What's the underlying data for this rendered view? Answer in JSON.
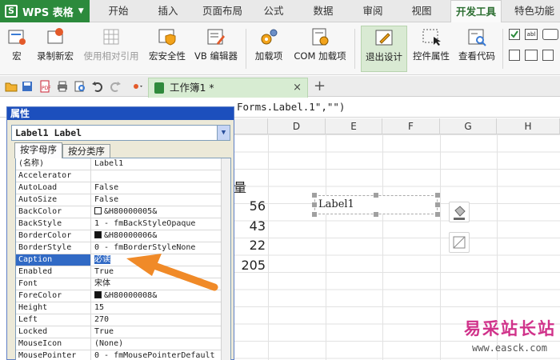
{
  "app": {
    "name": "WPS 表格",
    "logo_letter": "S"
  },
  "tabs": [
    {
      "label": "开始"
    },
    {
      "label": "插入"
    },
    {
      "label": "页面布局"
    },
    {
      "label": "公式"
    },
    {
      "label": "数据"
    },
    {
      "label": "审阅"
    },
    {
      "label": "视图"
    },
    {
      "label": "开发工具"
    },
    {
      "label": "特色功能"
    }
  ],
  "ribbon": {
    "macro": "宏",
    "record_macro": "录制新宏",
    "relative_ref": "使用相对引用",
    "macro_security": "宏安全性",
    "vb_editor": "VB 编辑器",
    "addins": "加载项",
    "com_addins": "COM 加载项",
    "exit_design": "退出设计",
    "control_props": "控件属性",
    "view_code": "查看代码"
  },
  "document": {
    "tab_name": "工作簿1 *",
    "close": "×",
    "new_tab": "+"
  },
  "formula_bar": {
    "content": "Forms.Label.1\",\"\")"
  },
  "sheet": {
    "columns": [
      "D",
      "E",
      "F",
      "G",
      "H"
    ],
    "partial_header": "量",
    "values": [
      "56",
      "43",
      "22",
      "205"
    ],
    "label_control_text": "Label1"
  },
  "properties": {
    "title": "属性",
    "object": "Label1 Label",
    "tab_alpha": "按字母序",
    "tab_category": "按分类序",
    "rows": [
      {
        "name": "(名称)",
        "value": "Label1"
      },
      {
        "name": "Accelerator",
        "value": ""
      },
      {
        "name": "AutoLoad",
        "value": "False"
      },
      {
        "name": "AutoSize",
        "value": "False"
      },
      {
        "name": "BackColor",
        "value": "&H80000005&",
        "swatch": "#ffffff"
      },
      {
        "name": "BackStyle",
        "value": "1 - fmBackStyleOpaque"
      },
      {
        "name": "BorderColor",
        "value": "&H80000006&",
        "swatch": "#111111"
      },
      {
        "name": "BorderStyle",
        "value": "0 - fmBorderStyleNone"
      },
      {
        "name": "Caption",
        "value": "必读",
        "selected": true
      },
      {
        "name": "Enabled",
        "value": "True"
      },
      {
        "name": "Font",
        "value": "宋体"
      },
      {
        "name": "ForeColor",
        "value": "&H80000008&",
        "swatch": "#111111"
      },
      {
        "name": "Height",
        "value": "15"
      },
      {
        "name": "Left",
        "value": "270"
      },
      {
        "name": "Locked",
        "value": "True"
      },
      {
        "name": "MouseIcon",
        "value": "(None)"
      },
      {
        "name": "MousePointer",
        "value": "0 - fmMousePointerDefault"
      }
    ]
  },
  "watermark": {
    "main": "易采站长站",
    "sub": "www.easck.com"
  },
  "colors": {
    "brand": "#2c8a3c",
    "selection": "#316ac5",
    "arrow": "#f08a28",
    "titlebar": "#1c4fbd"
  }
}
